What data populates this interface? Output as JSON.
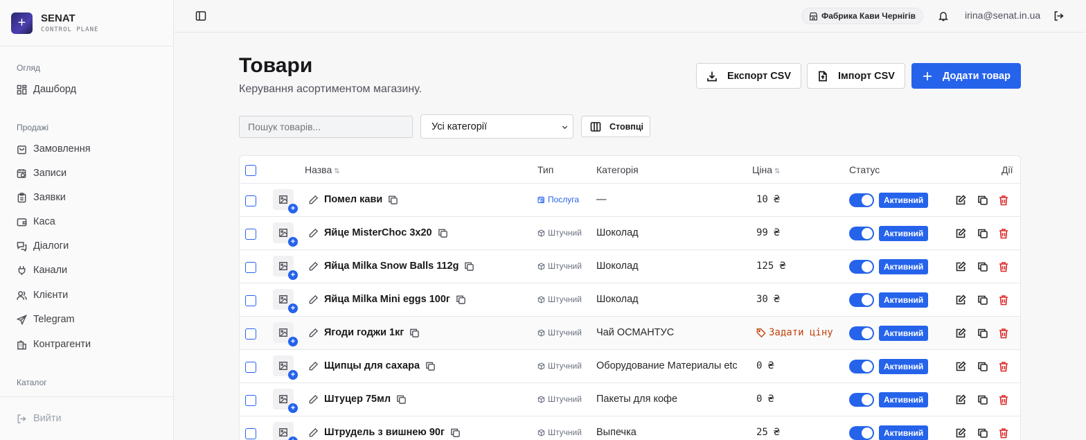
{
  "brand": {
    "title": "SENAT",
    "subtitle": "CONTROL PLANE"
  },
  "sidebar": {
    "sections": [
      {
        "label": "Огляд",
        "items": [
          {
            "label": "Дашборд",
            "icon": "dashboard-icon"
          }
        ]
      },
      {
        "label": "Продажі",
        "items": [
          {
            "label": "Замовлення",
            "icon": "shopping-bag-icon"
          },
          {
            "label": "Записи",
            "icon": "calendar-clock-icon"
          },
          {
            "label": "Заявки",
            "icon": "clipboard-icon"
          },
          {
            "label": "Каса",
            "icon": "wallet-icon"
          },
          {
            "label": "Діалоги",
            "icon": "messages-icon"
          },
          {
            "label": "Канали",
            "icon": "plug-icon"
          },
          {
            "label": "Клієнти",
            "icon": "users-icon"
          },
          {
            "label": "Telegram",
            "icon": "send-icon"
          },
          {
            "label": "Контрагенти",
            "icon": "building-icon"
          }
        ]
      },
      {
        "label": "Каталог",
        "items": []
      }
    ],
    "logout_label": "Вийти"
  },
  "header": {
    "store_name": "Фабрика Кави Чернігів",
    "user_email": "irina@senat.in.ua"
  },
  "page": {
    "title": "Товари",
    "subtitle": "Керування асортиментом магазину.",
    "export_label": "Експорт CSV",
    "import_label": "Імпорт CSV",
    "add_label": "Додати товар",
    "search_placeholder": "Пошук товарів...",
    "category_filter": "Усі категорії",
    "columns_label": "Стовпці"
  },
  "table": {
    "headers": {
      "name": "Назва",
      "type": "Тип",
      "category": "Категорія",
      "price": "Ціна",
      "status": "Статус",
      "actions": "Дії"
    },
    "rows": [
      {
        "name": "Помел кави",
        "type": "Послуга",
        "type_kind": "service",
        "category": "—",
        "price": "10 ₴",
        "status": "Активний",
        "enabled": true
      },
      {
        "name": "Яйце MisterChoc 3x20",
        "type": "Штучний",
        "type_kind": "unit",
        "category": "Шоколад",
        "price": "99 ₴",
        "status": "Активний",
        "enabled": true
      },
      {
        "name": "Яйца Milka Snow Balls 112g",
        "type": "Штучний",
        "type_kind": "unit",
        "category": "Шоколад",
        "price": "125 ₴",
        "status": "Активний",
        "enabled": true
      },
      {
        "name": "Яйца Milka Mini eggs 100г",
        "type": "Штучний",
        "type_kind": "unit",
        "category": "Шоколад",
        "price": "30 ₴",
        "status": "Активний",
        "enabled": true
      },
      {
        "name": "Ягоди годжи 1кг",
        "type": "Штучний",
        "type_kind": "unit",
        "category": "Чай ОСМАНТУС",
        "price": "",
        "price_action": "Задати ціну",
        "status": "Активний",
        "enabled": true
      },
      {
        "name": "Щипцы для сахара",
        "type": "Штучний",
        "type_kind": "unit",
        "category": "Оборудование Материалы etc",
        "price": "0 ₴",
        "status": "Активний",
        "enabled": true
      },
      {
        "name": "Штуцер 75мл",
        "type": "Штучний",
        "type_kind": "unit",
        "category": "Пакеты для кофе",
        "price": "0 ₴",
        "status": "Активний",
        "enabled": true
      },
      {
        "name": "Штрудель з вишнею 90г",
        "type": "Штучний",
        "type_kind": "unit",
        "category": "Выпечка",
        "price": "25 ₴",
        "status": "Активний",
        "enabled": true
      }
    ]
  },
  "colors": {
    "accent": "#2563eb",
    "danger": "#dc2626",
    "warning": "#c2410c"
  }
}
